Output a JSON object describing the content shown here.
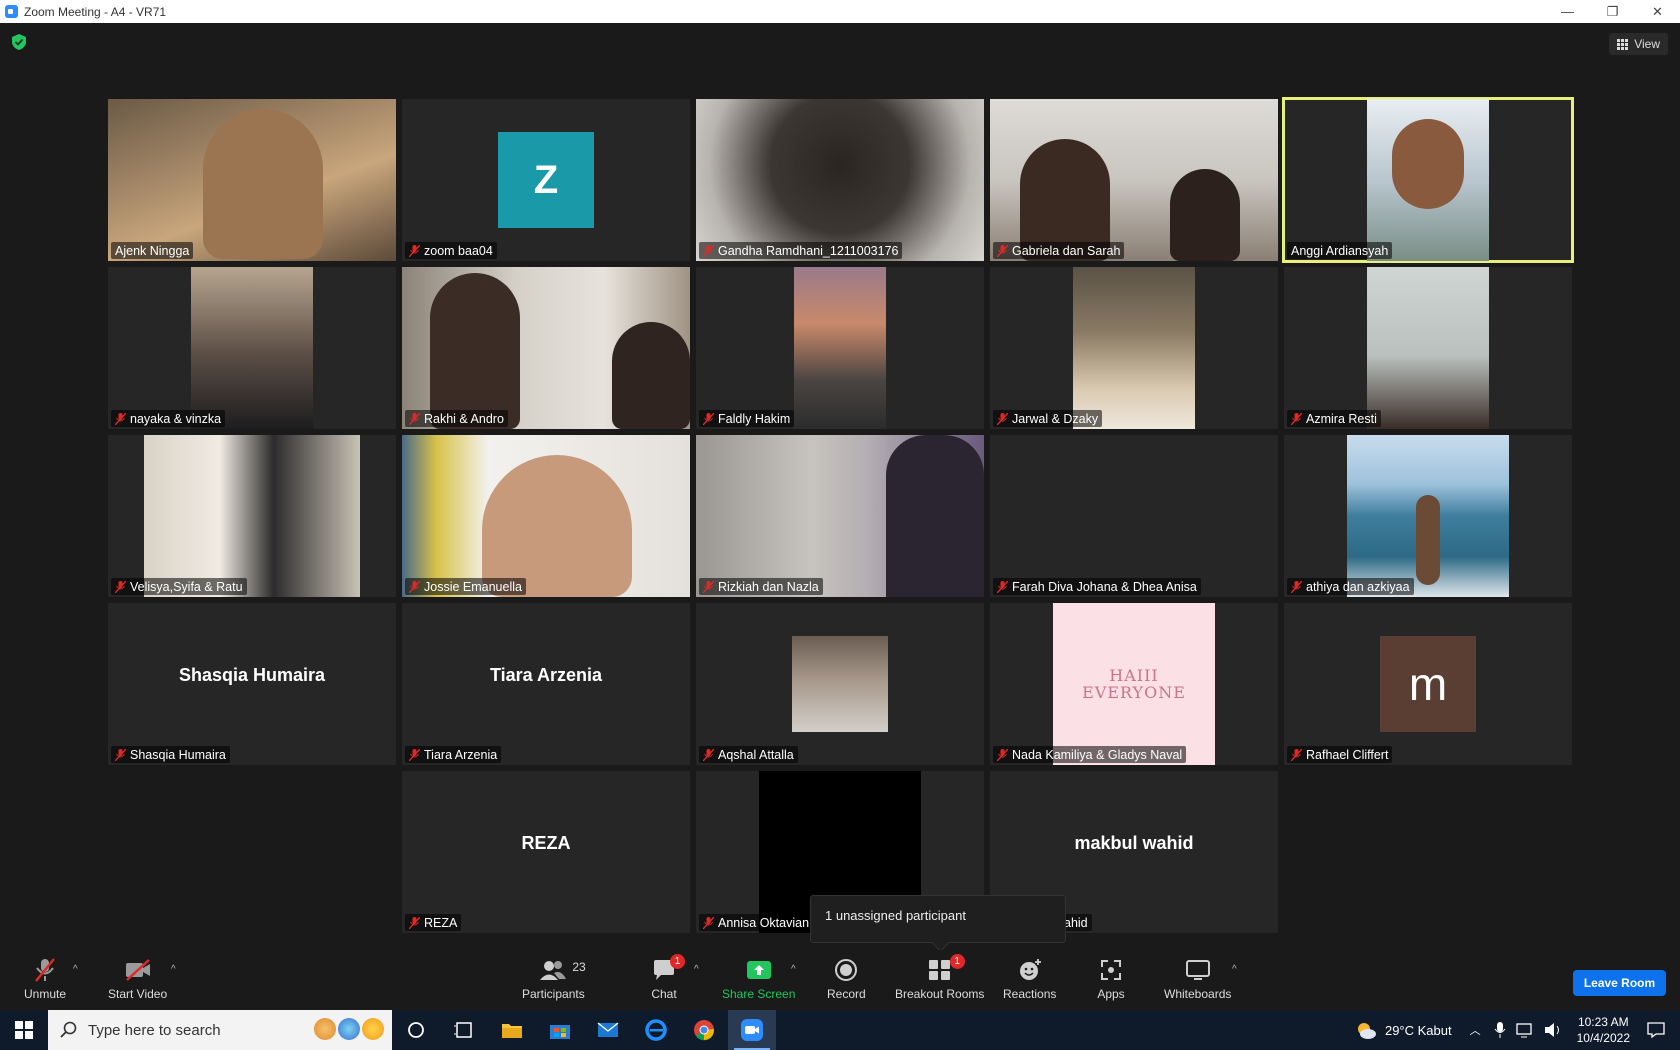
{
  "window": {
    "title": "Zoom Meeting - A4 - VR71",
    "controls": [
      "—",
      "❐",
      "✕"
    ]
  },
  "top": {
    "view_label": "View"
  },
  "participants": [
    {
      "name": "Ajenk Ningga",
      "muted": false
    },
    {
      "name": "zoom baa04",
      "muted": true,
      "avatar_letter": "Z"
    },
    {
      "name": "Gandha Ramdhani_1211003176",
      "muted": true
    },
    {
      "name": "Gabriela dan Sarah",
      "muted": true
    },
    {
      "name": "Anggi Ardiansyah",
      "muted": false,
      "active_speaker": true
    },
    {
      "name": "nayaka & vinzka",
      "muted": true
    },
    {
      "name": "Rakhi & Andro",
      "muted": true
    },
    {
      "name": "Faldly Hakim",
      "muted": true
    },
    {
      "name": "Jarwal & Dzaky",
      "muted": true
    },
    {
      "name": "Azmira Resti",
      "muted": true
    },
    {
      "name": "Velisya,Syifa & Ratu",
      "muted": true
    },
    {
      "name": "Jossie Emanuella",
      "muted": true
    },
    {
      "name": "Rizkiah dan Nazla",
      "muted": true
    },
    {
      "name": "Farah Diva Johana & Dhea Anisa",
      "muted": true
    },
    {
      "name": "athiya dan azkiyaa",
      "muted": true
    },
    {
      "name": "Shasqia Humaira",
      "muted": true,
      "display_name": "Shasqia Humaira"
    },
    {
      "name": "Tiara Arzenia",
      "muted": true,
      "display_name": "Tiara Arzenia"
    },
    {
      "name": "Aqshal Attalla",
      "muted": true
    },
    {
      "name": "Nada Kamiliya & Gladys Naval",
      "muted": true,
      "image_text": "HAIII EVERYONE"
    },
    {
      "name": "Rafhael Cliffert",
      "muted": true,
      "avatar_letter": "m"
    },
    {
      "name": "REZA",
      "muted": true,
      "display_name": "REZA"
    },
    {
      "name": "Annisa Oktavian",
      "muted": true
    },
    {
      "name": "ahid",
      "muted": true,
      "display_name": "makbul wahid"
    }
  ],
  "tooltip": {
    "text": "1 unassigned participant"
  },
  "toolbar": {
    "unmute": "Unmute",
    "start_video": "Start Video",
    "participants": "Participants",
    "participants_count": "23",
    "chat": "Chat",
    "chat_badge": "1",
    "share_screen": "Share Screen",
    "record": "Record",
    "breakout_rooms": "Breakout Rooms",
    "breakout_badge": "1",
    "reactions": "Reactions",
    "apps": "Apps",
    "whiteboards": "Whiteboards",
    "leave_room": "Leave Room",
    "caret": "^"
  },
  "taskbar": {
    "search_placeholder": "Type here to search",
    "weather": "29°C  Kabut",
    "time": "10:23 AM",
    "date": "10/4/2022"
  },
  "colors": {
    "share_green": "#22c55e",
    "leave_blue": "#0e72ed",
    "badge_red": "#e02828",
    "active_border": "#e6f07a",
    "muted_red": "#e02828"
  }
}
